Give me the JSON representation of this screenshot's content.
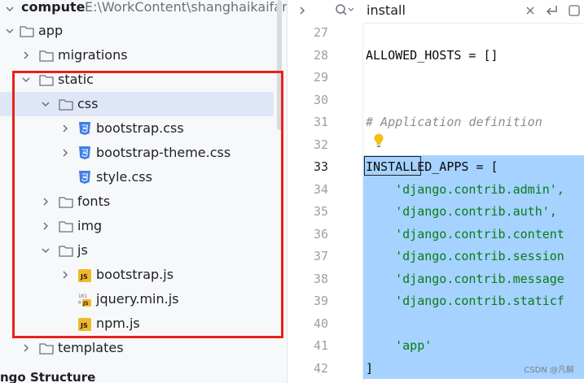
{
  "tree": {
    "root_name": "compute",
    "root_path": "E:\\WorkContent\\shanghaikaifang",
    "items": [
      {
        "label": "app",
        "type": "folder",
        "expanded": true
      },
      {
        "label": "migrations",
        "type": "folder",
        "expanded": false
      },
      {
        "label": "static",
        "type": "folder",
        "expanded": true
      },
      {
        "label": "css",
        "type": "folder",
        "expanded": true,
        "selected": true
      },
      {
        "label": "bootstrap.css",
        "type": "css-file"
      },
      {
        "label": "bootstrap-theme.css",
        "type": "css-file"
      },
      {
        "label": "style.css",
        "type": "css-file"
      },
      {
        "label": "fonts",
        "type": "folder",
        "expanded": false
      },
      {
        "label": "img",
        "type": "folder",
        "expanded": false
      },
      {
        "label": "js",
        "type": "folder",
        "expanded": true
      },
      {
        "label": "bootstrap.js",
        "type": "js-file"
      },
      {
        "label": "jquery.min.js",
        "type": "minjs-file"
      },
      {
        "label": "npm.js",
        "type": "js-file"
      },
      {
        "label": "templates",
        "type": "folder",
        "expanded": false
      }
    ],
    "structure_label": "ngo Structure"
  },
  "search": {
    "query": "install"
  },
  "editor": {
    "line_numbers": [
      "27",
      "28",
      "29",
      "30",
      "31",
      "32",
      "33",
      "34",
      "35",
      "36",
      "37",
      "38",
      "39",
      "40",
      "41",
      "42"
    ],
    "current_line": "33",
    "lines": {
      "l28": "ALLOWED_HOSTS = []",
      "l31": "# Application definition",
      "l33": "INSTALLED_APPS = [",
      "l34": "    'django.contrib.admin',",
      "l35": "    'django.contrib.auth',",
      "l36": "    'django.contrib.content",
      "l37": "    'django.contrib.session",
      "l38": "    'django.contrib.message",
      "l39": "    'django.contrib.staticf",
      "l41": "    'app'",
      "l42": "]"
    }
  },
  "watermark": "CSDN @凡解",
  "colors": {
    "highlight_box": "#e8221b",
    "selection": "#a6d2ff",
    "string": "#067d17",
    "comment": "#8c8c8c",
    "css_icon": "#3d7fe6",
    "js_icon": "#f1b828"
  }
}
